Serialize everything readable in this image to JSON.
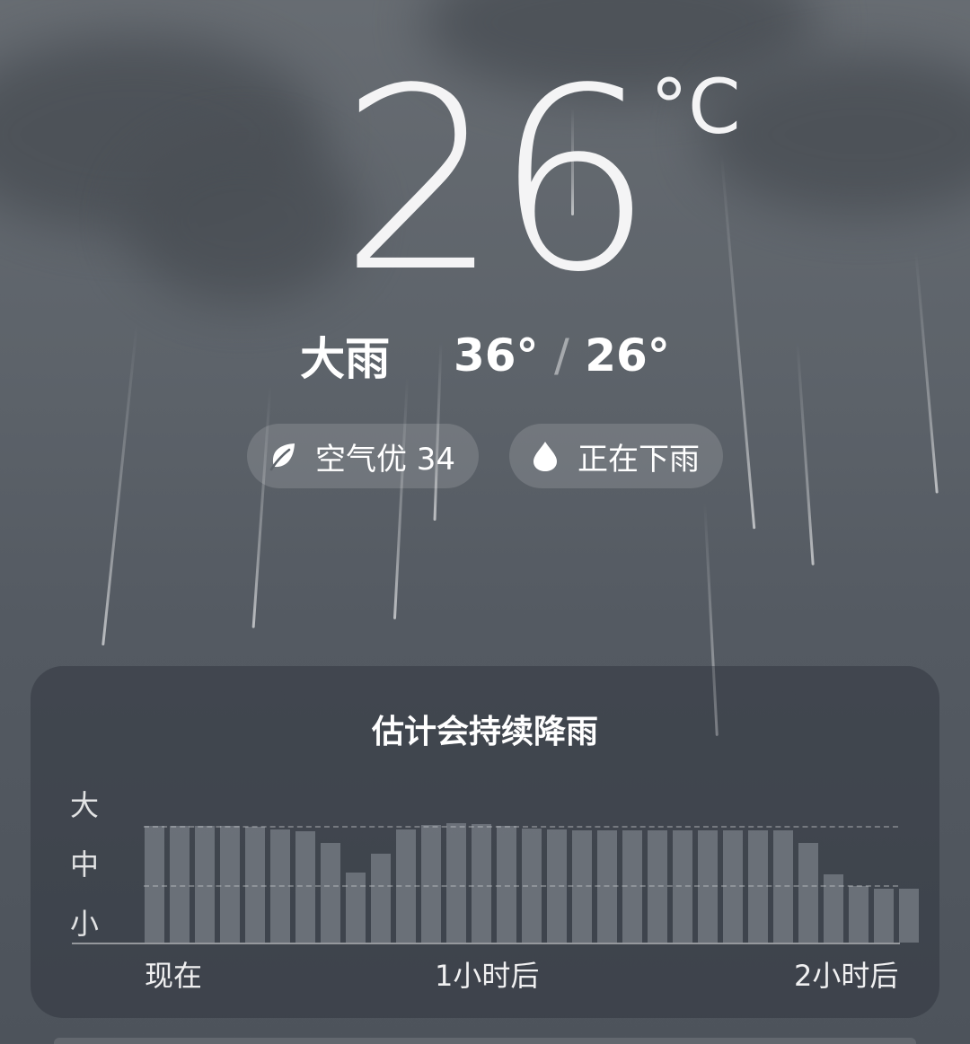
{
  "weather": {
    "temperature": "26",
    "unit": "°C",
    "condition": "大雨",
    "high": "36°",
    "separator": "/",
    "low": "26°"
  },
  "chips": {
    "air": {
      "label": "空气优 34",
      "icon": "leaf-icon"
    },
    "rain": {
      "label": "正在下雨",
      "icon": "water-drop-icon"
    }
  },
  "forecast": {
    "title": "估计会持续降雨",
    "y_labels": {
      "heavy": "大",
      "medium": "中",
      "light": "小"
    },
    "x_labels": {
      "now": "现在",
      "one_hour": "1小时后",
      "two_hours": "2小时后"
    }
  },
  "chart_data": {
    "type": "bar",
    "title": "估计会持续降雨",
    "y_categories": [
      "小",
      "中",
      "大"
    ],
    "ylim": [
      0,
      3
    ],
    "x_tick_labels": [
      "现在",
      "1小时后",
      "2小时后"
    ],
    "values": [
      1.98,
      1.98,
      1.98,
      1.98,
      1.97,
      1.92,
      1.9,
      1.69,
      1.19,
      1.51,
      1.93,
      2.0,
      2.03,
      2.01,
      1.99,
      1.94,
      1.92,
      1.91,
      1.91,
      1.91,
      1.91,
      1.91,
      1.91,
      1.91,
      1.91,
      1.91,
      1.69,
      1.16,
      0.96,
      0.92,
      0.92
    ],
    "gridlines": [
      1,
      2
    ],
    "grid": true
  }
}
